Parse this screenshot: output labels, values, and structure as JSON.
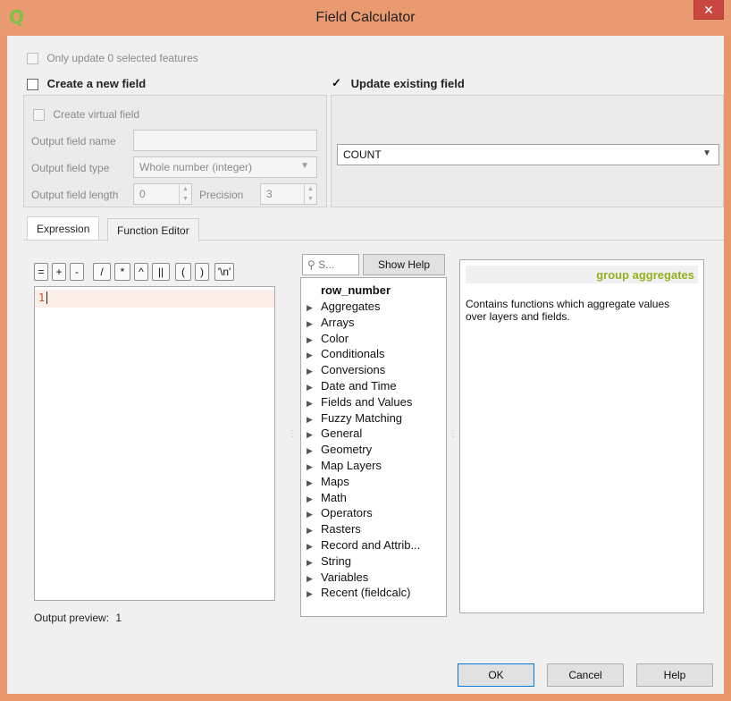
{
  "window": {
    "title": "Field Calculator",
    "app_icon_glyph": "Q",
    "close_glyph": "✕",
    "accent_color": "#e9966c"
  },
  "only_update": {
    "label": "Only update 0 selected features",
    "checked": false,
    "enabled": false
  },
  "create_new_field": {
    "label": "Create a new field",
    "checked": false,
    "virtual_label": "Create virtual field",
    "output_name_label": "Output field name",
    "output_name_value": "",
    "output_type_label": "Output field type",
    "output_type_value": "Whole number (integer)",
    "output_length_label": "Output field length",
    "output_length_value": "0",
    "precision_label": "Precision",
    "precision_value": "3"
  },
  "update_existing": {
    "label": "Update existing field",
    "checked": true,
    "field": "COUNT"
  },
  "tabs": [
    {
      "label": "Expression",
      "active": true
    },
    {
      "label": "Function Editor",
      "active": false
    }
  ],
  "operators": [
    "=",
    "+",
    "-",
    "/",
    "*",
    "^",
    "||",
    "(",
    ")",
    "'\\n'"
  ],
  "editor": {
    "line_number": "1",
    "text": ""
  },
  "search": {
    "placeholder": "S...",
    "icon": "search-icon"
  },
  "show_help_label": "Show Help",
  "function_tree": {
    "first": "row_number",
    "groups": [
      "Aggregates",
      "Arrays",
      "Color",
      "Conditionals",
      "Conversions",
      "Date and Time",
      "Fields and Values",
      "Fuzzy Matching",
      "General",
      "Geometry",
      "Map Layers",
      "Maps",
      "Math",
      "Operators",
      "Rasters",
      "Record and Attrib...",
      "String",
      "Variables",
      "Recent (fieldcalc)"
    ]
  },
  "help": {
    "heading": "group aggregates",
    "heading_color": "#93b21f",
    "body": "Contains functions which aggregate values over layers and fields."
  },
  "output_preview": {
    "label": "Output preview:",
    "value": "1"
  },
  "buttons": {
    "ok": "OK",
    "cancel": "Cancel",
    "help": "Help"
  }
}
